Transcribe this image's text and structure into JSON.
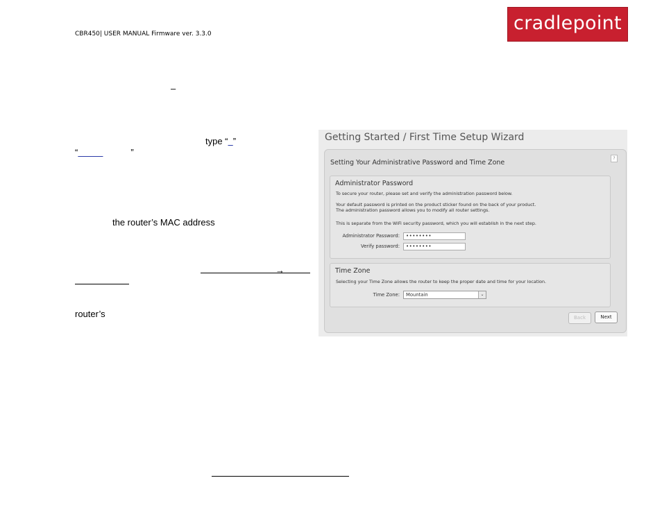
{
  "header": {
    "manual_title": "CBR450| USER MANUAL Firmware ver. 3.3.0",
    "logo_text": "cradlepoint"
  },
  "body": {
    "dash_fragment": "–",
    "type_fragment": "type “",
    "type_link": "  ",
    "type_close": "”",
    "quote_open": "“",
    "quote_link": "          ",
    "quote_close": "”",
    "mac_line": "the router’s MAC address",
    "arrow": "→",
    "routers_line": "router’s"
  },
  "screenshot": {
    "window_title": "Getting Started / First Time Setup Wizard",
    "help_glyph": "?",
    "panel_title": "Setting Your Administrative Password and Time Zone",
    "admin": {
      "title": "Administrator Password",
      "line1": "To secure your router, please set and verify the administration password below.",
      "line2": "Your default password is printed on the product sticker found on the back of your product.",
      "line3": "The administration password allows you to modify all router settings.",
      "line4": "This is separate from the WiFi security password, which you will establish in the next step.",
      "admin_label": "Administrator Password:",
      "admin_value": "••••••••",
      "verify_label": "Verify password:",
      "verify_value": "••••••••"
    },
    "timezone": {
      "title": "Time Zone",
      "description": "Selecting your Time Zone allows the router to keep the proper date and time for your location.",
      "label": "Time Zone:",
      "selected": "Mountain",
      "arrow_glyph": "⌄"
    },
    "buttons": {
      "back": "Back",
      "next": "Next"
    }
  },
  "colors": {
    "logo_red": "#c8202f",
    "link_blue": "#2a3aa8"
  }
}
